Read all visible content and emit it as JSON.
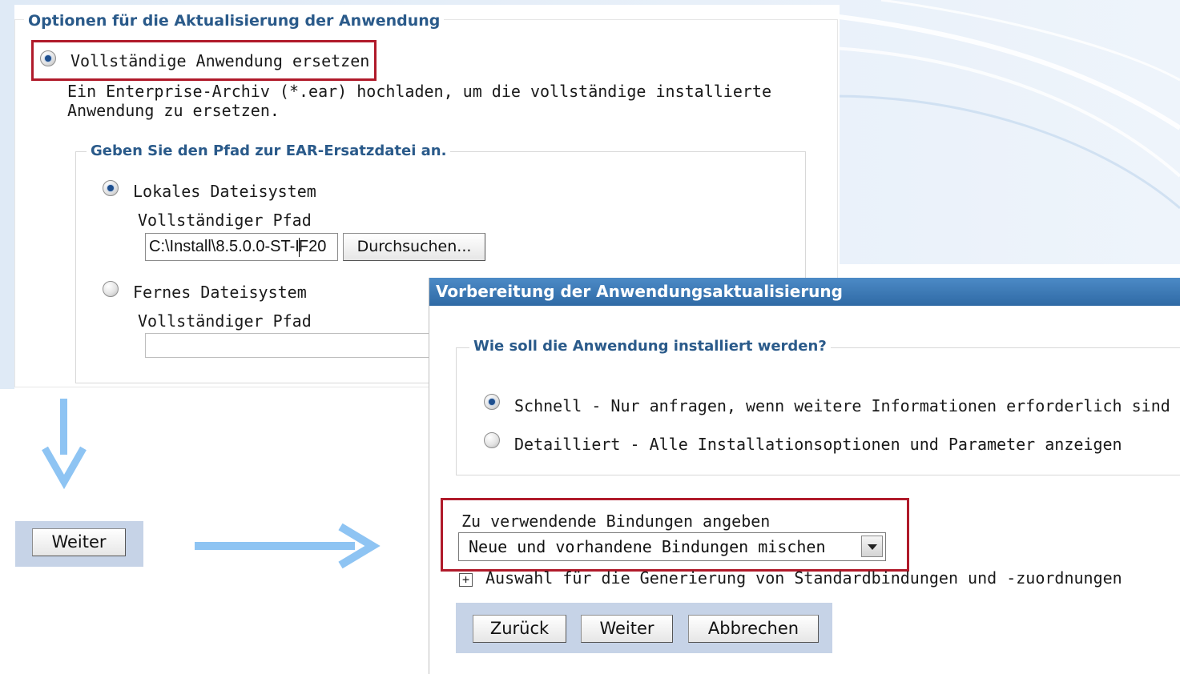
{
  "update_options": {
    "legend": "Optionen für die Aktualisierung der Anwendung",
    "replace_radio_label": "Vollständige Anwendung ersetzen",
    "replace_description": "Ein Enterprise-Archiv (*.ear) hochladen, um die vollständige installierte Anwendung zu ersetzen.",
    "path_legend": "Geben Sie den Pfad zur EAR-Ersatzdatei an.",
    "local": {
      "radio_label": "Lokales Dateisystem",
      "path_label": "Vollständiger Pfad",
      "path_value_before_caret": "C:\\Install\\8.5.0.0-ST-I",
      "path_value_after_caret": "F20",
      "browse_button": "Durchsuchen..."
    },
    "remote": {
      "radio_label": "Fernes Dateisystem",
      "path_label": "Vollständiger Pfad",
      "path_value": ""
    }
  },
  "standalone_next_button": "Weiter",
  "dialog": {
    "title": "Vorbereitung der Anwendungsaktualisierung",
    "install_legend": "Wie soll die Anwendung installiert werden?",
    "options": [
      {
        "label": "Schnell - Nur anfragen, wenn weitere Informationen erforderlich sind",
        "selected": true
      },
      {
        "label": "Detailliert - Alle Installationsoptionen und Parameter anzeigen",
        "selected": false
      }
    ],
    "bindings_label": "Zu verwendende Bindungen angeben",
    "bindings_value": "Neue und vorhandene Bindungen mischen",
    "expander_label": "Auswahl für die Generierung von Standardbindungen und -zuordnungen",
    "buttons": {
      "back": "Zurück",
      "next": "Weiter",
      "cancel": "Abbrechen"
    }
  },
  "colors": {
    "highlight": "#b01a2a",
    "arrow": "#8ec4f3",
    "title_bar": "#3a78b6",
    "legend_text": "#2a5a8a"
  }
}
